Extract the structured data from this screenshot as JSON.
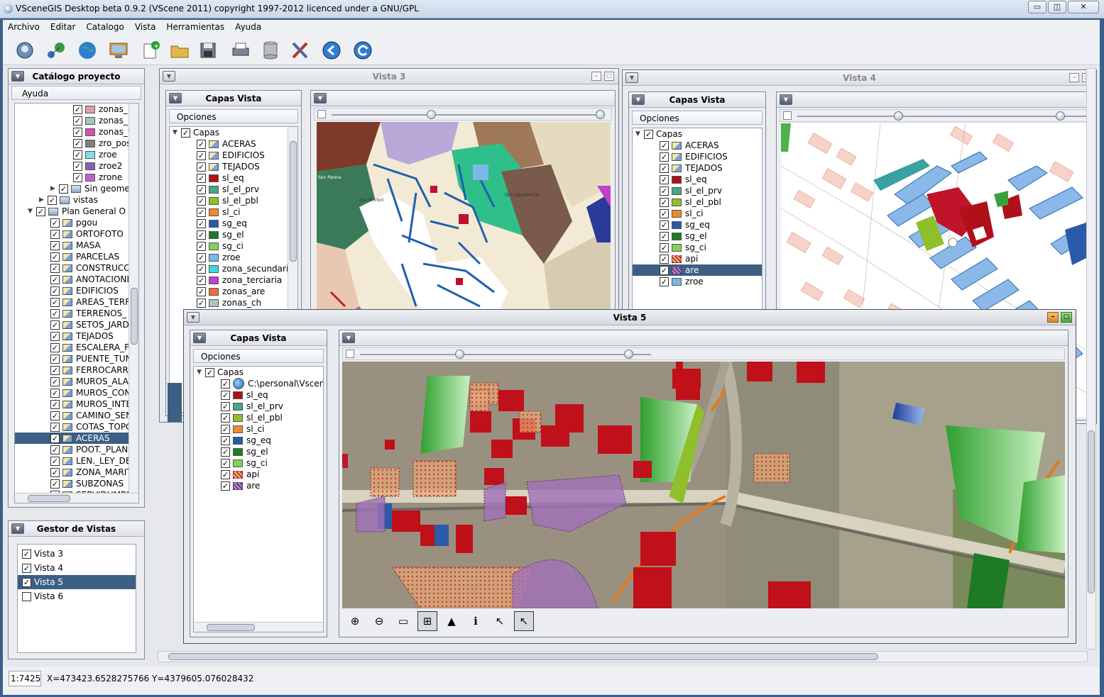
{
  "app": {
    "title": "VSceneGIS Desktop  beta 0.9.2    (VScene 2011) copyright 1997-2012 licenced under a GNU/GPL"
  },
  "window_buttons": {
    "minimize": "▭",
    "maximize": "◫",
    "close": "✕"
  },
  "menu": [
    "Archivo",
    "Editar",
    "Catalogo",
    "Vista",
    "Herramientas",
    "Ayuda"
  ],
  "toolbar": [
    "connect-icon",
    "network-icon",
    "globe-icon",
    "computer-icon",
    "new-document-icon",
    "open-folder-icon",
    "save-icon",
    "print-icon",
    "database-icon",
    "tools-icon",
    "back-icon",
    "refresh-icon"
  ],
  "catalog": {
    "title": "Catálogo proyecto",
    "menu": "Ayuda",
    "items": [
      {
        "label": "zonas_",
        "color": "#d9a2a2",
        "indent": 2,
        "checked": true
      },
      {
        "label": "zonas_",
        "color": "#9fc9b6",
        "indent": 2,
        "checked": true
      },
      {
        "label": "zonas_t",
        "color": "#d94fb0",
        "indent": 2,
        "checked": true
      },
      {
        "label": "zro_pos",
        "color": "#7f7f7f",
        "indent": 2,
        "checked": true
      },
      {
        "label": "zroe",
        "color": "#7fe0e8",
        "indent": 2,
        "checked": true
      },
      {
        "label": "zroe2",
        "color": "#8060c0",
        "indent": 2,
        "checked": true
      },
      {
        "label": "zrone",
        "color": "#c060d0",
        "indent": 2,
        "checked": true
      },
      {
        "label": "Sin geome",
        "color": "",
        "indent": 1,
        "checked": true,
        "folder": true
      },
      {
        "label": "vistas",
        "color": "",
        "indent": 0,
        "checked": true,
        "folder": true
      },
      {
        "label": "Plan General O",
        "color": "",
        "indent": -1,
        "checked": true,
        "folder": true,
        "open": true
      },
      {
        "label": "pgou",
        "indent": 0,
        "checked": true
      },
      {
        "label": "ORTOFOTO",
        "indent": 0,
        "checked": true
      },
      {
        "label": "MASA",
        "indent": 0,
        "checked": true
      },
      {
        "label": "PARCELAS",
        "indent": 0,
        "checked": true
      },
      {
        "label": "CONSTRUCC",
        "indent": 0,
        "checked": true
      },
      {
        "label": "ANOTACIONE",
        "indent": 0,
        "checked": true
      },
      {
        "label": "EDIFICIOS",
        "indent": 0,
        "checked": true
      },
      {
        "label": "AREAS_TERF",
        "indent": 0,
        "checked": true
      },
      {
        "label": "TERRENOS_",
        "indent": 0,
        "checked": true
      },
      {
        "label": "SETOS_JARD",
        "indent": 0,
        "checked": true
      },
      {
        "label": "TEJADOS",
        "indent": 0,
        "checked": true
      },
      {
        "label": "ESCALERA_F",
        "indent": 0,
        "checked": true
      },
      {
        "label": "PUENTE_TUN",
        "indent": 0,
        "checked": true
      },
      {
        "label": "FERROCARR",
        "indent": 0,
        "checked": true
      },
      {
        "label": "MUROS_ALAN",
        "indent": 0,
        "checked": true
      },
      {
        "label": "MUROS_CON",
        "indent": 0,
        "checked": true
      },
      {
        "label": "MUROS_INTE",
        "indent": 0,
        "checked": true
      },
      {
        "label": "CAMINO_SEN",
        "indent": 0,
        "checked": true
      },
      {
        "label": "COTAS_TOPC",
        "indent": 0,
        "checked": true
      },
      {
        "label": "ACERAS",
        "indent": 0,
        "checked": true,
        "selected": true
      },
      {
        "label": "POOT._PLAN",
        "indent": 0,
        "checked": true
      },
      {
        "label": "LEN._LEY_DE",
        "indent": 0,
        "checked": true
      },
      {
        "label": "ZONA_MARIT",
        "indent": 0,
        "checked": true
      },
      {
        "label": "SUBZONAS",
        "indent": 0,
        "checked": true
      },
      {
        "label": "SERVIDUMBR",
        "indent": 0,
        "checked": true
      }
    ]
  },
  "gestor": {
    "title": "Gestor de Vistas",
    "items": [
      {
        "label": "Vista 3",
        "checked": true
      },
      {
        "label": "Vista 4",
        "checked": true
      },
      {
        "label": "Vista 5",
        "checked": true,
        "selected": true
      },
      {
        "label": "Vista 6",
        "checked": false
      }
    ]
  },
  "vista3": {
    "title": "Vista 3",
    "capas_title": "Capas Vista",
    "opciones": "Opciones",
    "root": "Capas",
    "layers": [
      {
        "label": "ACERAS",
        "color": "vector"
      },
      {
        "label": "EDIFICIOS",
        "color": "vector"
      },
      {
        "label": "TEJADOS",
        "color": "vector"
      },
      {
        "label": "sl_eq",
        "color": "#b0101a"
      },
      {
        "label": "sl_el_prv",
        "color": "#4aa58a"
      },
      {
        "label": "sl_el_pbl",
        "color": "#8fbf2a"
      },
      {
        "label": "sl_ci",
        "color": "#f08a30"
      },
      {
        "label": "sg_eq",
        "color": "#2a5aa8"
      },
      {
        "label": "sg_el",
        "color": "#1e7a24"
      },
      {
        "label": "sg_ci",
        "color": "#86d05a"
      },
      {
        "label": "zroe",
        "color": "#7ab8e8"
      },
      {
        "label": "zona_secundari",
        "color": "#40d8e0"
      },
      {
        "label": "zona_terciaria",
        "color": "#c040d0"
      },
      {
        "label": "zonas_are",
        "color": "#f06c40"
      },
      {
        "label": "zonas_ch",
        "color": "#a8c8b8"
      }
    ]
  },
  "vista4": {
    "title": "Vista 4",
    "capas_title": "Capas Vista",
    "opciones": "Opciones",
    "root": "Capas",
    "layers": [
      {
        "label": "ACERAS",
        "color": "vector"
      },
      {
        "label": "EDIFICIOS",
        "color": "vector"
      },
      {
        "label": "TEJADOS",
        "color": "vector"
      },
      {
        "label": "sl_eq",
        "color": "#b0101a"
      },
      {
        "label": "sl_el_prv",
        "color": "#4aa58a"
      },
      {
        "label": "sl_el_pbl",
        "color": "#8fbf2a"
      },
      {
        "label": "sl_ci",
        "color": "#f08a30"
      },
      {
        "label": "sg_eq",
        "color": "#2a5aa8"
      },
      {
        "label": "sg_el",
        "color": "#1e7a24"
      },
      {
        "label": "sg_ci",
        "color": "#86d05a"
      },
      {
        "label": "api",
        "color": "hatch-orange"
      },
      {
        "label": "are",
        "color": "hatch-purple",
        "selected": true
      },
      {
        "label": "zroe",
        "color": "#7ab8e8"
      }
    ]
  },
  "vista5": {
    "title": "Vista 5",
    "capas_title": "Capas Vista",
    "opciones": "Opciones",
    "root": "Capas",
    "layers": [
      {
        "label": "C:\\personal\\Vscen",
        "color": "globe"
      },
      {
        "label": "sl_eq",
        "color": "#b0101a"
      },
      {
        "label": "sl_el_prv",
        "color": "#4aa58a"
      },
      {
        "label": "sl_el_pbl",
        "color": "#8fbf2a"
      },
      {
        "label": "sl_ci",
        "color": "#f08a30"
      },
      {
        "label": "sg_eq",
        "color": "#2a5aa8"
      },
      {
        "label": "sg_el",
        "color": "#1e7a24"
      },
      {
        "label": "sg_ci",
        "color": "#86d05a"
      },
      {
        "label": "api",
        "color": "hatch-orange"
      },
      {
        "label": "are",
        "color": "hatch-purple"
      }
    ],
    "map_tools": [
      {
        "icon": "zoom-in-icon",
        "glyph": "⊕"
      },
      {
        "icon": "zoom-out-icon",
        "glyph": "⊖"
      },
      {
        "icon": "full-extent-icon",
        "glyph": "▭"
      },
      {
        "icon": "zoom-box-icon",
        "glyph": "⊞",
        "active": true
      },
      {
        "icon": "image-icon",
        "glyph": "▲"
      },
      {
        "icon": "info-icon",
        "glyph": "ℹ"
      },
      {
        "icon": "select-arrow-icon",
        "glyph": "↖"
      },
      {
        "icon": "pointer-icon",
        "glyph": "↖",
        "active": true
      }
    ]
  },
  "map_labels": {
    "son_mortori": "Son Mortori",
    "ses_calapates": "SES CALAPATES",
    "son_parera": "Son Parera"
  },
  "status": {
    "scale": "1:7425",
    "coords": "X=473423.6528275766  Y=4379605.076028432"
  }
}
